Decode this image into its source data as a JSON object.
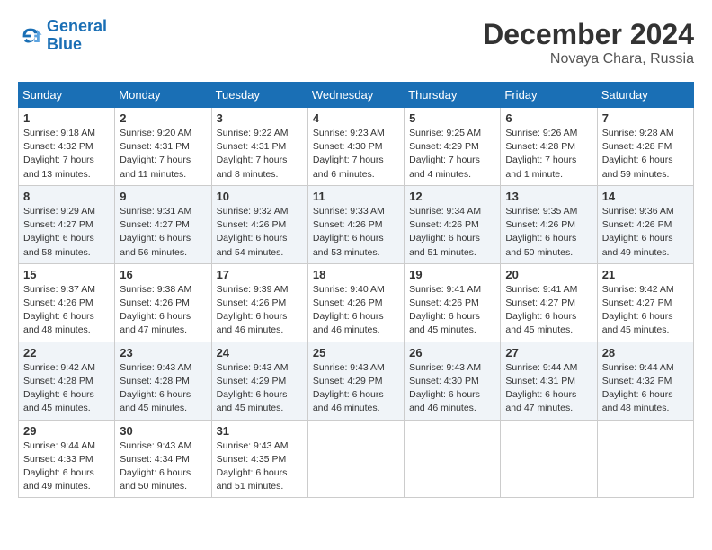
{
  "header": {
    "logo_line1": "General",
    "logo_line2": "Blue",
    "month": "December 2024",
    "location": "Novaya Chara, Russia"
  },
  "days_of_week": [
    "Sunday",
    "Monday",
    "Tuesday",
    "Wednesday",
    "Thursday",
    "Friday",
    "Saturday"
  ],
  "weeks": [
    [
      {
        "day": "1",
        "sunrise": "9:18 AM",
        "sunset": "4:32 PM",
        "daylight": "7 hours and 13 minutes."
      },
      {
        "day": "2",
        "sunrise": "9:20 AM",
        "sunset": "4:31 PM",
        "daylight": "7 hours and 11 minutes."
      },
      {
        "day": "3",
        "sunrise": "9:22 AM",
        "sunset": "4:31 PM",
        "daylight": "7 hours and 8 minutes."
      },
      {
        "day": "4",
        "sunrise": "9:23 AM",
        "sunset": "4:30 PM",
        "daylight": "7 hours and 6 minutes."
      },
      {
        "day": "5",
        "sunrise": "9:25 AM",
        "sunset": "4:29 PM",
        "daylight": "7 hours and 4 minutes."
      },
      {
        "day": "6",
        "sunrise": "9:26 AM",
        "sunset": "4:28 PM",
        "daylight": "7 hours and 1 minute."
      },
      {
        "day": "7",
        "sunrise": "9:28 AM",
        "sunset": "4:28 PM",
        "daylight": "6 hours and 59 minutes."
      }
    ],
    [
      {
        "day": "8",
        "sunrise": "9:29 AM",
        "sunset": "4:27 PM",
        "daylight": "6 hours and 58 minutes."
      },
      {
        "day": "9",
        "sunrise": "9:31 AM",
        "sunset": "4:27 PM",
        "daylight": "6 hours and 56 minutes."
      },
      {
        "day": "10",
        "sunrise": "9:32 AM",
        "sunset": "4:26 PM",
        "daylight": "6 hours and 54 minutes."
      },
      {
        "day": "11",
        "sunrise": "9:33 AM",
        "sunset": "4:26 PM",
        "daylight": "6 hours and 53 minutes."
      },
      {
        "day": "12",
        "sunrise": "9:34 AM",
        "sunset": "4:26 PM",
        "daylight": "6 hours and 51 minutes."
      },
      {
        "day": "13",
        "sunrise": "9:35 AM",
        "sunset": "4:26 PM",
        "daylight": "6 hours and 50 minutes."
      },
      {
        "day": "14",
        "sunrise": "9:36 AM",
        "sunset": "4:26 PM",
        "daylight": "6 hours and 49 minutes."
      }
    ],
    [
      {
        "day": "15",
        "sunrise": "9:37 AM",
        "sunset": "4:26 PM",
        "daylight": "6 hours and 48 minutes."
      },
      {
        "day": "16",
        "sunrise": "9:38 AM",
        "sunset": "4:26 PM",
        "daylight": "6 hours and 47 minutes."
      },
      {
        "day": "17",
        "sunrise": "9:39 AM",
        "sunset": "4:26 PM",
        "daylight": "6 hours and 46 minutes."
      },
      {
        "day": "18",
        "sunrise": "9:40 AM",
        "sunset": "4:26 PM",
        "daylight": "6 hours and 46 minutes."
      },
      {
        "day": "19",
        "sunrise": "9:41 AM",
        "sunset": "4:26 PM",
        "daylight": "6 hours and 45 minutes."
      },
      {
        "day": "20",
        "sunrise": "9:41 AM",
        "sunset": "4:27 PM",
        "daylight": "6 hours and 45 minutes."
      },
      {
        "day": "21",
        "sunrise": "9:42 AM",
        "sunset": "4:27 PM",
        "daylight": "6 hours and 45 minutes."
      }
    ],
    [
      {
        "day": "22",
        "sunrise": "9:42 AM",
        "sunset": "4:28 PM",
        "daylight": "6 hours and 45 minutes."
      },
      {
        "day": "23",
        "sunrise": "9:43 AM",
        "sunset": "4:28 PM",
        "daylight": "6 hours and 45 minutes."
      },
      {
        "day": "24",
        "sunrise": "9:43 AM",
        "sunset": "4:29 PM",
        "daylight": "6 hours and 45 minutes."
      },
      {
        "day": "25",
        "sunrise": "9:43 AM",
        "sunset": "4:29 PM",
        "daylight": "6 hours and 46 minutes."
      },
      {
        "day": "26",
        "sunrise": "9:43 AM",
        "sunset": "4:30 PM",
        "daylight": "6 hours and 46 minutes."
      },
      {
        "day": "27",
        "sunrise": "9:44 AM",
        "sunset": "4:31 PM",
        "daylight": "6 hours and 47 minutes."
      },
      {
        "day": "28",
        "sunrise": "9:44 AM",
        "sunset": "4:32 PM",
        "daylight": "6 hours and 48 minutes."
      }
    ],
    [
      {
        "day": "29",
        "sunrise": "9:44 AM",
        "sunset": "4:33 PM",
        "daylight": "6 hours and 49 minutes."
      },
      {
        "day": "30",
        "sunrise": "9:43 AM",
        "sunset": "4:34 PM",
        "daylight": "6 hours and 50 minutes."
      },
      {
        "day": "31",
        "sunrise": "9:43 AM",
        "sunset": "4:35 PM",
        "daylight": "6 hours and 51 minutes."
      },
      null,
      null,
      null,
      null
    ]
  ]
}
